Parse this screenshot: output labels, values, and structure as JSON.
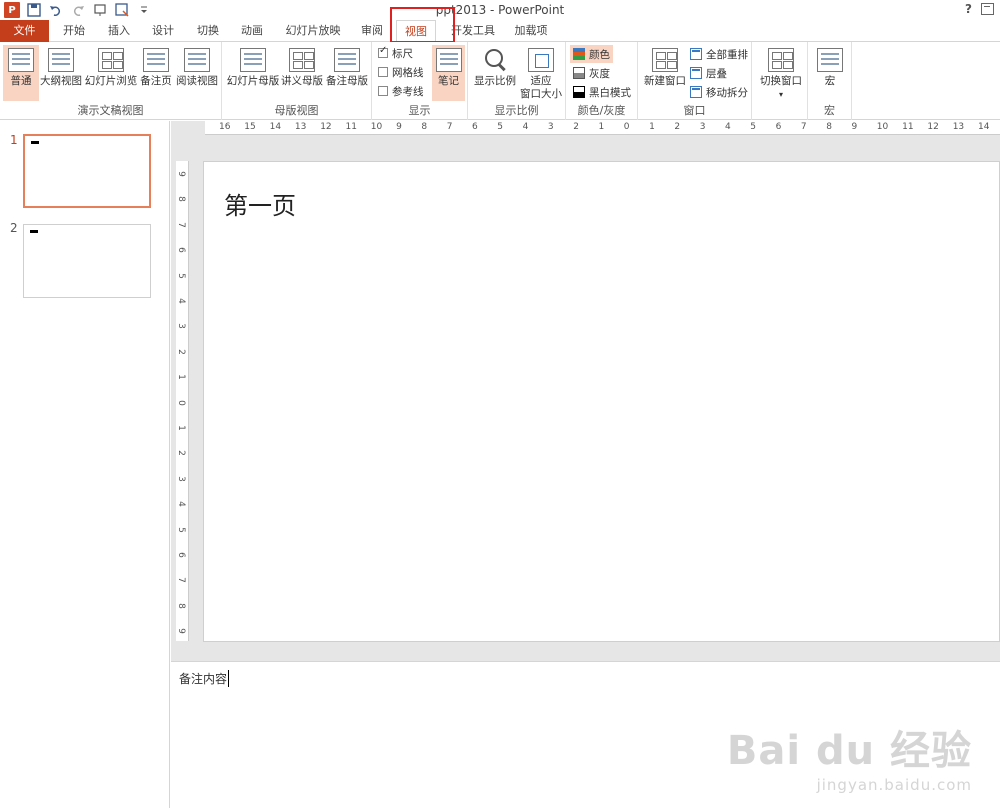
{
  "window": {
    "title": "ppt2013 - PowerPoint",
    "help": "?",
    "app_icon": "P"
  },
  "qat": {
    "icons": [
      "powerpoint-app-icon",
      "save-icon",
      "undo-icon",
      "redo-icon",
      "start-from-beginning-icon",
      "save-as-icon",
      "customize-qat-icon"
    ]
  },
  "tabs": [
    {
      "label": "文件"
    },
    {
      "label": "开始"
    },
    {
      "label": "插入"
    },
    {
      "label": "设计"
    },
    {
      "label": "切换"
    },
    {
      "label": "动画"
    },
    {
      "label": "幻灯片放映"
    },
    {
      "label": "审阅"
    },
    {
      "label": "视图"
    },
    {
      "label": "开发工具"
    },
    {
      "label": "加载项"
    }
  ],
  "active_tab": "视图",
  "ribbon": {
    "presentation_views": {
      "label": "演示文稿视图",
      "buttons": [
        "普通",
        "大纲视图",
        "幻灯片浏览",
        "备注页",
        "阅读视图"
      ]
    },
    "master_views": {
      "label": "母版视图",
      "buttons": [
        "幻灯片母版",
        "讲义母版",
        "备注母版"
      ]
    },
    "show": {
      "label": "显示",
      "checks": [
        {
          "label": "标尺",
          "checked": true
        },
        {
          "label": "网格线",
          "checked": false
        },
        {
          "label": "参考线",
          "checked": false
        }
      ],
      "notes_button": "笔记"
    },
    "zoom": {
      "label": "显示比例",
      "zoom_button": "显示比例",
      "fit_button_line1": "适应",
      "fit_button_line2": "窗口大小"
    },
    "color_gray": {
      "label": "颜色/灰度",
      "options": [
        "颜色",
        "灰度",
        "黑白模式"
      ]
    },
    "window": {
      "label": "窗口",
      "new_window": "新建窗口",
      "options": [
        "全部重排",
        "层叠",
        "移动拆分"
      ]
    },
    "switch_window": {
      "label": "切换窗口"
    },
    "macros": {
      "label": "宏",
      "button": "宏"
    }
  },
  "slides": [
    {
      "number": "1"
    },
    {
      "number": "2"
    }
  ],
  "hruler_labels": [
    "16",
    "15",
    "14",
    "13",
    "12",
    "11",
    "10",
    "9",
    "8",
    "7",
    "6",
    "5",
    "4",
    "3",
    "2",
    "1",
    "0",
    "1",
    "2",
    "3",
    "4",
    "5",
    "6",
    "7",
    "8",
    "9",
    "10",
    "11",
    "12",
    "13",
    "14"
  ],
  "vruler_labels": [
    "9",
    "8",
    "7",
    "6",
    "5",
    "4",
    "3",
    "2",
    "1",
    "0",
    "1",
    "2",
    "3",
    "4",
    "5",
    "6",
    "7",
    "8",
    "9"
  ],
  "slide_content": {
    "title": "第一页"
  },
  "notes": {
    "text": "备注内容"
  },
  "watermark": {
    "logo": "Bai du 经验",
    "sub": "jingyan.baidu.com"
  },
  "colors": {
    "accent": "#c43e1c",
    "selected_bg": "#f9d4c3",
    "highlight": "#e02020"
  }
}
